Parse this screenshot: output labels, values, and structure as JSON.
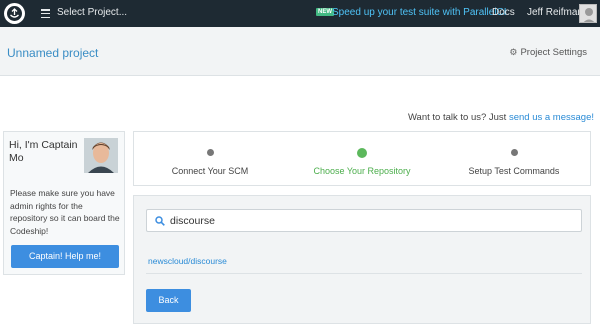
{
  "topbar": {
    "project_select": "Select Project...",
    "new_badge": "NEW",
    "promo": "Speed up your test suite with ParallelCI",
    "docs": "Docs",
    "username": "Jeff Reifman"
  },
  "header": {
    "project_name": "Unnamed project",
    "settings_label": "Project Settings"
  },
  "talk": {
    "prefix": "Want to talk to us? Just ",
    "link": "send us a message!"
  },
  "captain": {
    "greeting": "Hi, I'm Captain Mo",
    "message": "Please make sure you have admin rights for the repository so it can board the Codeship!",
    "help_button": "Captain! Help me!"
  },
  "steps": [
    {
      "label": "Connect Your SCM"
    },
    {
      "label": "Choose Your Repository"
    },
    {
      "label": "Setup Test Commands"
    }
  ],
  "repo": {
    "search_value": "discourse",
    "result": "newscloud/discourse",
    "back_button": "Back"
  },
  "colors": {
    "topbar": "#1e2a33",
    "accent": "#3d8ee0",
    "active_step": "#5cb85c",
    "link": "#2a8bd6"
  }
}
